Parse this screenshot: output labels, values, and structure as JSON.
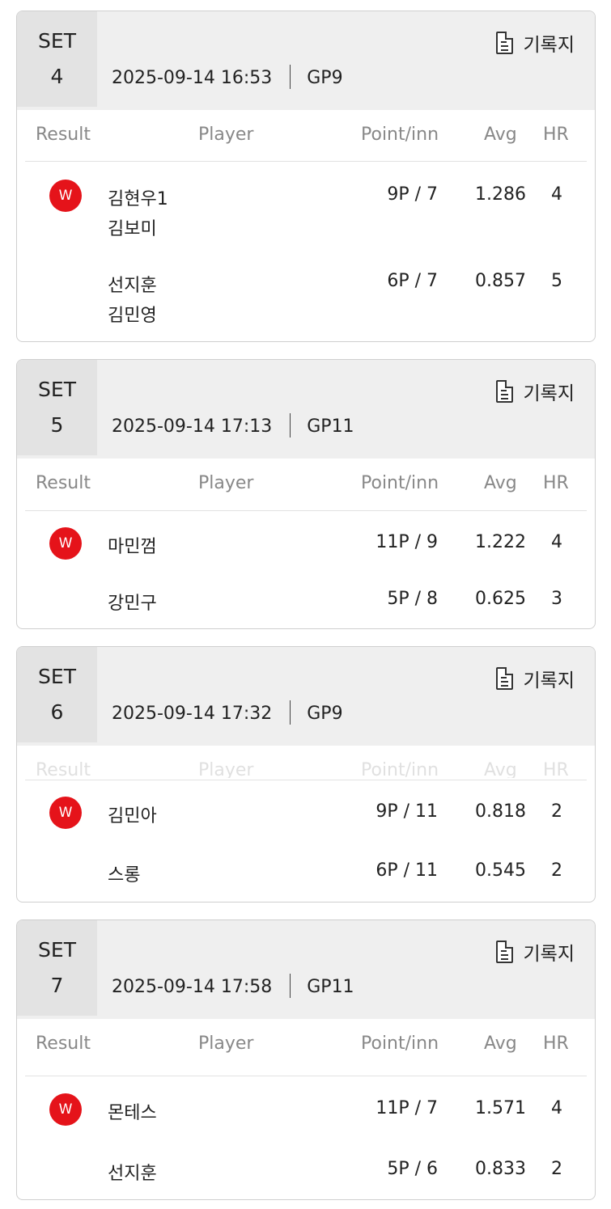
{
  "headers": {
    "result": "Result",
    "player": "Player",
    "point": "Point/inn",
    "avg": "Avg",
    "hr": "HR"
  },
  "record_label": "기록지",
  "set_label": "SET",
  "result_win": "W",
  "sets": [
    {
      "no": "4",
      "datetime": "2025-09-14 16:53",
      "table": "GP9",
      "rows": [
        {
          "win": true,
          "players": [
            "김현우1",
            "김보미"
          ],
          "point": "9P / 7",
          "avg": "1.286",
          "hr": "4"
        },
        {
          "win": false,
          "players": [
            "선지훈",
            "김민영"
          ],
          "point": "6P / 7",
          "avg": "0.857",
          "hr": "5"
        }
      ]
    },
    {
      "no": "5",
      "datetime": "2025-09-14 17:13",
      "table": "GP11",
      "rows": [
        {
          "win": true,
          "players": [
            "마민껌"
          ],
          "point": "11P / 9",
          "avg": "1.222",
          "hr": "4"
        },
        {
          "win": false,
          "players": [
            "강민구"
          ],
          "point": "5P / 8",
          "avg": "0.625",
          "hr": "3"
        }
      ]
    },
    {
      "no": "6",
      "datetime": "2025-09-14 17:32",
      "table": "GP9",
      "rows": [
        {
          "win": true,
          "players": [
            "김민아"
          ],
          "point": "9P / 11",
          "avg": "0.818",
          "hr": "2"
        },
        {
          "win": false,
          "players": [
            "스롱"
          ],
          "point": "6P / 11",
          "avg": "0.545",
          "hr": "2"
        }
      ]
    },
    {
      "no": "7",
      "datetime": "2025-09-14 17:58",
      "table": "GP11",
      "rows": [
        {
          "win": true,
          "players": [
            "몬테스"
          ],
          "point": "11P / 7",
          "avg": "1.571",
          "hr": "4"
        },
        {
          "win": false,
          "players": [
            "선지훈"
          ],
          "point": "5P / 6",
          "avg": "0.833",
          "hr": "2"
        }
      ]
    }
  ]
}
